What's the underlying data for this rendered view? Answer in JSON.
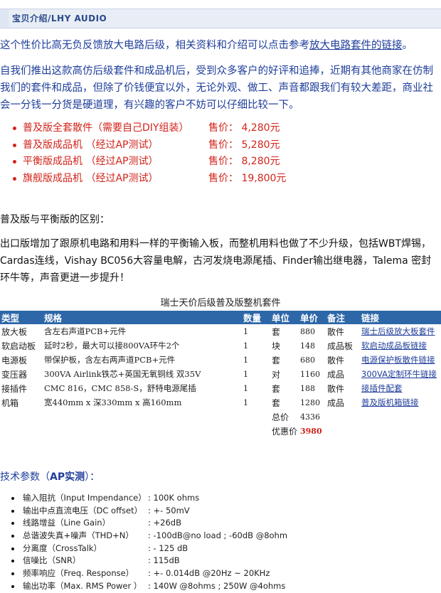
{
  "header": {
    "title": "宝贝介绍/LHY AUDIO"
  },
  "intro": {
    "text_before": "这个性价比高无负反馈放大电路后级，相关资料和介绍可以点击参考",
    "link_text": "放大电路套件的链接",
    "text_after": "。"
  },
  "intro2": "自我们推出这款高仿后级套件和成品机后，受到众多客户的好评和追捧，近期有其他商家在仿制我们的套件和成品，但除了价钱便宜以外，无论外观、做工、声音都跟我们有较大差距，商业社会一分钱一分货是硬道理，有兴趣的客户不妨可以仔细比较一下。",
  "prices": [
    {
      "name": "普及版全套散件（需要自己DIY组装）",
      "price": "售价：  4,280元"
    },
    {
      "name": "普及版成品机  （经过AP测试）",
      "price": "售价：  5,280元"
    },
    {
      "name": "平衡版成品机  （经过AP测试）",
      "price": "售价：  8,280元"
    },
    {
      "name": "旗舰版成品机  （经过AP测试）",
      "price": "售价：  19,800元"
    }
  ],
  "diff": {
    "title": "普及版与平衡版的区别：",
    "body": "出口版增加了跟原机电路和用料一样的平衡输入板，而整机用料也做了不少升级，包括WBT焊锡，Cardas连线，Vishay BC056大容量电解，古河发烧电源尾插、Finder输出继电器，Talema 密封环牛等，声音更进一步提升！"
  },
  "table": {
    "title": "瑞士天价后级普及版整机套件",
    "headers": [
      "类型",
      "规格",
      "数量",
      "单位",
      "单价",
      "备注",
      "链接"
    ],
    "rows": [
      [
        "放大板",
        "含左右声道PCB+元件",
        "1",
        "套",
        "880",
        "散件",
        "瑞士后级放大板套件"
      ],
      [
        "软启动板",
        "延时2秒，最大可以接800VA环牛2个",
        "1",
        "块",
        "148",
        "成品板",
        "软启动成品板链接"
      ],
      [
        "电源板",
        "带保护板，含左右两声道PCB+元件",
        "1",
        "套",
        "680",
        "散件",
        "电源保护板散件链接"
      ],
      [
        "变压器",
        "300VA Airlink铁芯+英国无氧铜线 双35V",
        "1",
        "对",
        "1160",
        "成品",
        "300VA定制环牛链接"
      ],
      [
        "接插件",
        "CMC 816，CMC 858-S，舒特电源尾插",
        "1",
        "套",
        "188",
        "散件",
        "接插件配套"
      ],
      [
        "机箱",
        "宽440mm x 深330mm x 高160mm",
        "1",
        "套",
        "1280",
        "成品",
        "普及版机箱链接"
      ]
    ],
    "total_label": "总价",
    "total_value": "4336",
    "discount_label": "优惠价",
    "discount_value": "3980"
  },
  "specs": {
    "title_prefix": "技术参数（",
    "title_bold": "AP实测",
    "title_suffix": "）：",
    "items": [
      {
        "label": "输入阻抗（Input Impendance）",
        "value": ": 100K ohms"
      },
      {
        "label": "输出中点直流电压（DC offset）",
        "value": ": +- 50mV"
      },
      {
        "label": "线路增益（Line Gain）",
        "value": ": +26dB"
      },
      {
        "label": "总谐波失真+噪声（THD+N）",
        "value": ": -100dB@no load ; -60dB @8ohm"
      },
      {
        "label": "分离度（CrossTalk）",
        "value": ": - 125 dB"
      },
      {
        "label": "信噪比（SNR）",
        "value": ": 115dB"
      },
      {
        "label": "频率响应（Freq. Response）",
        "value": ": +- 0.014dB @20Hz ~ 20KHz"
      },
      {
        "label": "输出功率（Max. RMS Power ）",
        "value": ": 140W @8ohms ; 250W @4ohms"
      }
    ]
  }
}
